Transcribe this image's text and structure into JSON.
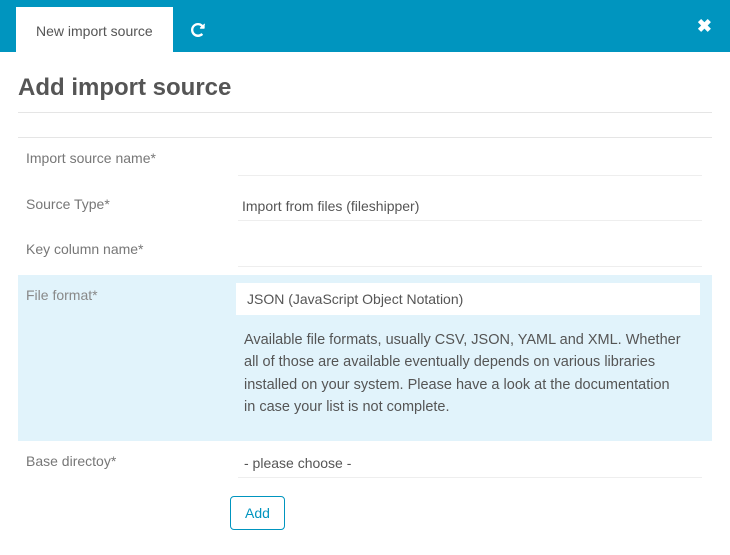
{
  "header": {
    "tab_label": "New import source"
  },
  "page": {
    "title": "Add import source"
  },
  "form": {
    "import_source_name": {
      "label": "Import source name*",
      "value": ""
    },
    "source_type": {
      "label": "Source Type*",
      "value": "Import from files (fileshipper)"
    },
    "key_column_name": {
      "label": "Key column name*",
      "value": ""
    },
    "file_format": {
      "label": "File format*",
      "value": "JSON (JavaScript Object Notation)",
      "help": "Available file formats, usually CSV, JSON, YAML and XML. Whether all of those are available eventually depends on various libraries installed on your system. Please have a look at the documentation in case your list is not complete."
    },
    "base_directory": {
      "label": "Base directoy*",
      "value": " - please choose - "
    }
  },
  "buttons": {
    "add": "Add"
  }
}
